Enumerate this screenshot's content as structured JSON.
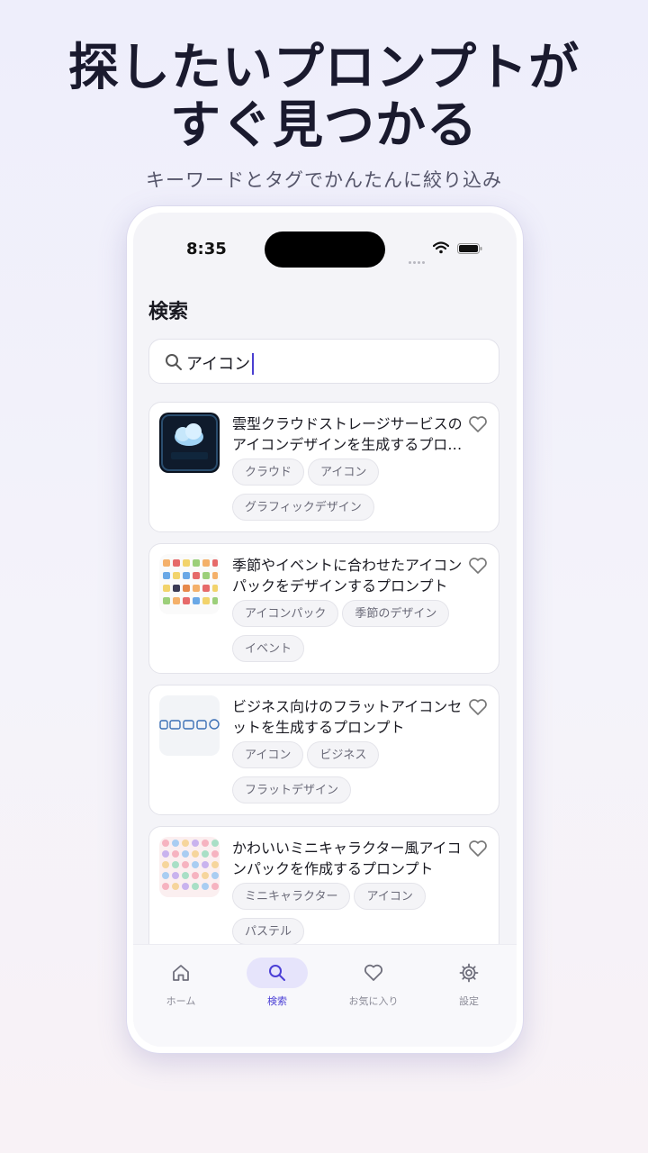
{
  "hero": {
    "title_line1": "探したいプロンプトが",
    "title_line2": "すぐ見つかる",
    "subtitle": "キーワードとタグでかんたんに絞り込み"
  },
  "status_bar": {
    "time": "8:35"
  },
  "page": {
    "title": "検索"
  },
  "search": {
    "value": "アイコン",
    "icon": "search-icon"
  },
  "results": [
    {
      "title": "雲型クラウドストレージサービスのアイコンデザインを生成するプロ…",
      "tags": [
        "クラウド",
        "アイコン",
        "グラフィックデザイン"
      ],
      "thumb_text": "クラウド ストレージ"
    },
    {
      "title": "季節やイベントに合わせたアイコンパックをデザインするプロンプト",
      "tags": [
        "アイコンパック",
        "季節のデザイン",
        "イベント"
      ]
    },
    {
      "title": "ビジネス向けのフラットアイコンセットを生成するプロンプト",
      "tags": [
        "アイコン",
        "ビジネス",
        "フラットデザイン"
      ]
    },
    {
      "title": "かわいいミニキャラクター風アイコンパックを作成するプロンプト",
      "tags": [
        "ミニキャラクター",
        "アイコン",
        "パステル"
      ]
    }
  ],
  "tabbar": [
    {
      "label": "ホーム",
      "icon": "home-icon",
      "active": false
    },
    {
      "label": "検索",
      "icon": "search-icon",
      "active": true
    },
    {
      "label": "お気に入り",
      "icon": "heart-icon",
      "active": false
    },
    {
      "label": "設定",
      "icon": "gear-icon",
      "active": false
    }
  ],
  "colors": {
    "accent": "#4b3fd6",
    "active_tab_bg": "#e6e4fb",
    "headline": "#1a1a2e"
  }
}
